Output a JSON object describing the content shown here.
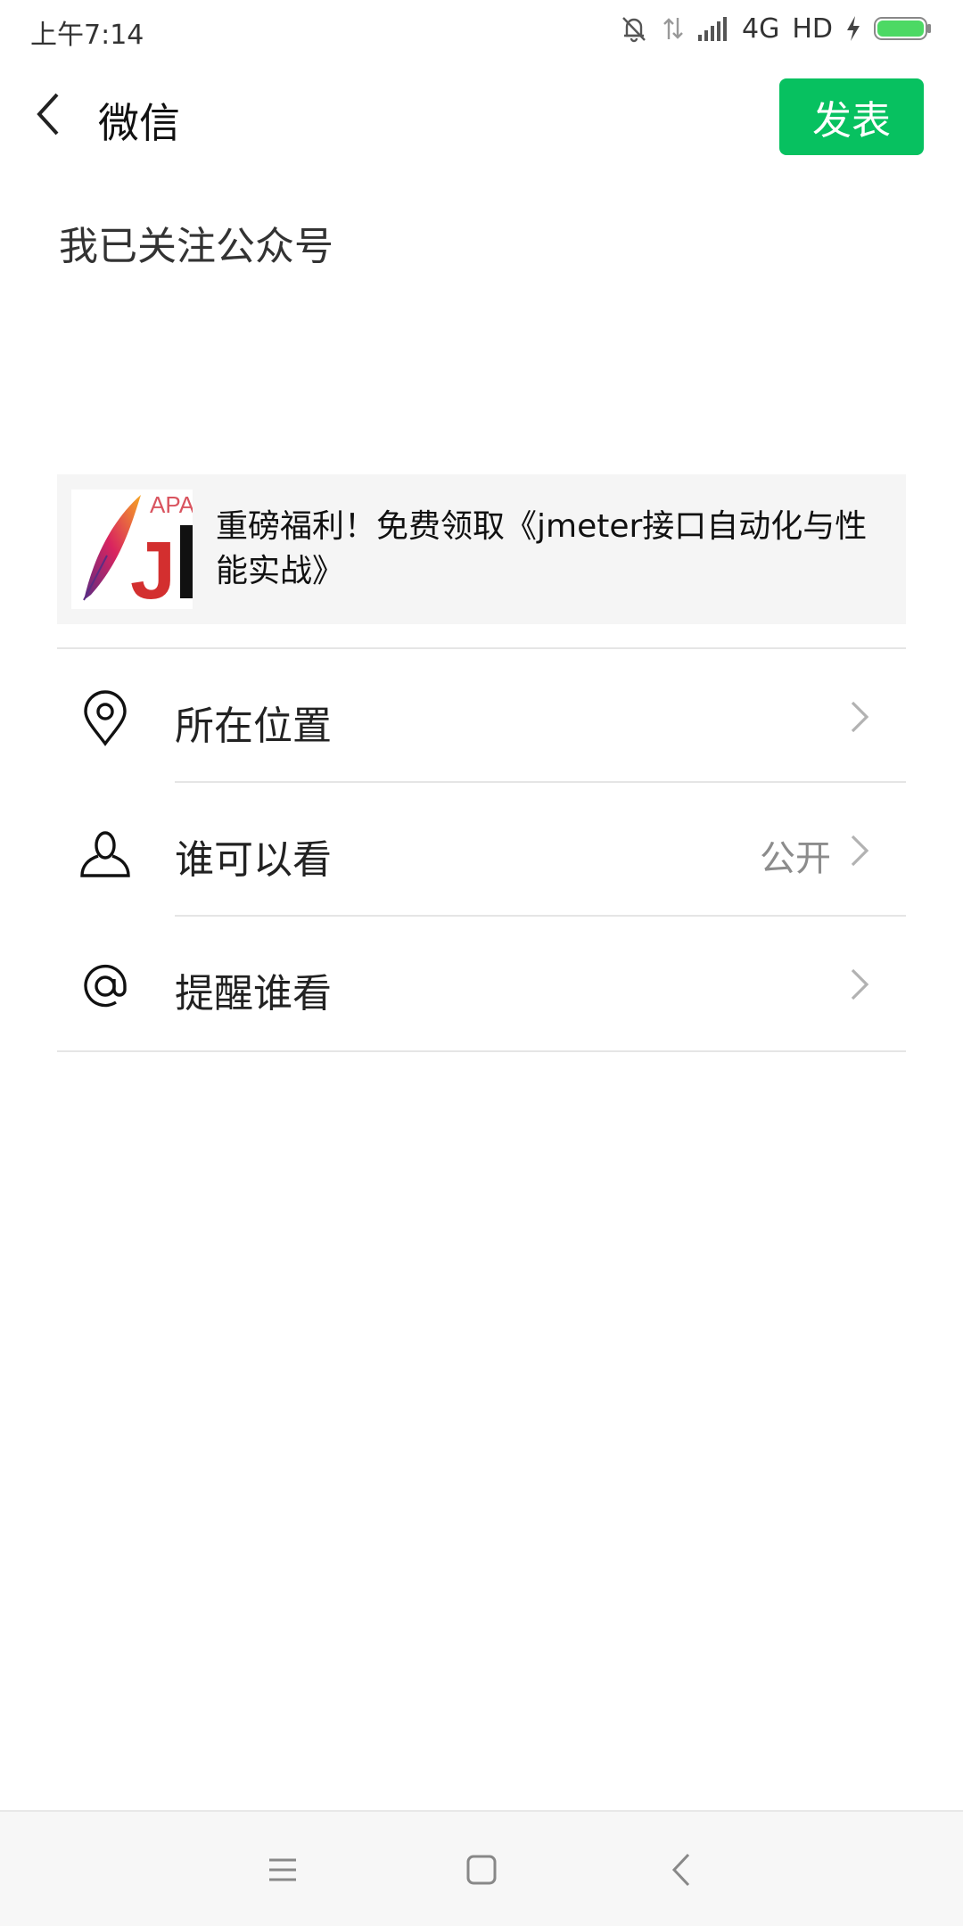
{
  "status_bar": {
    "time": "上午7:14",
    "network": "4G",
    "hd": "HD"
  },
  "header": {
    "title": "微信",
    "publish_label": "发表"
  },
  "post": {
    "text": "我已关注公众号"
  },
  "shared_article": {
    "title": "重磅福利！免费领取《jmeter接口自动化与性能实战》",
    "thumb_text": "APA JM"
  },
  "options": [
    {
      "label": "所在位置",
      "value": "",
      "icon": "location-pin-icon"
    },
    {
      "label": "谁可以看",
      "value": "公开",
      "icon": "person-icon"
    },
    {
      "label": "提醒谁看",
      "value": "",
      "icon": "at-sign-icon"
    }
  ],
  "colors": {
    "accent": "#07c160",
    "battery": "#4cd964"
  }
}
